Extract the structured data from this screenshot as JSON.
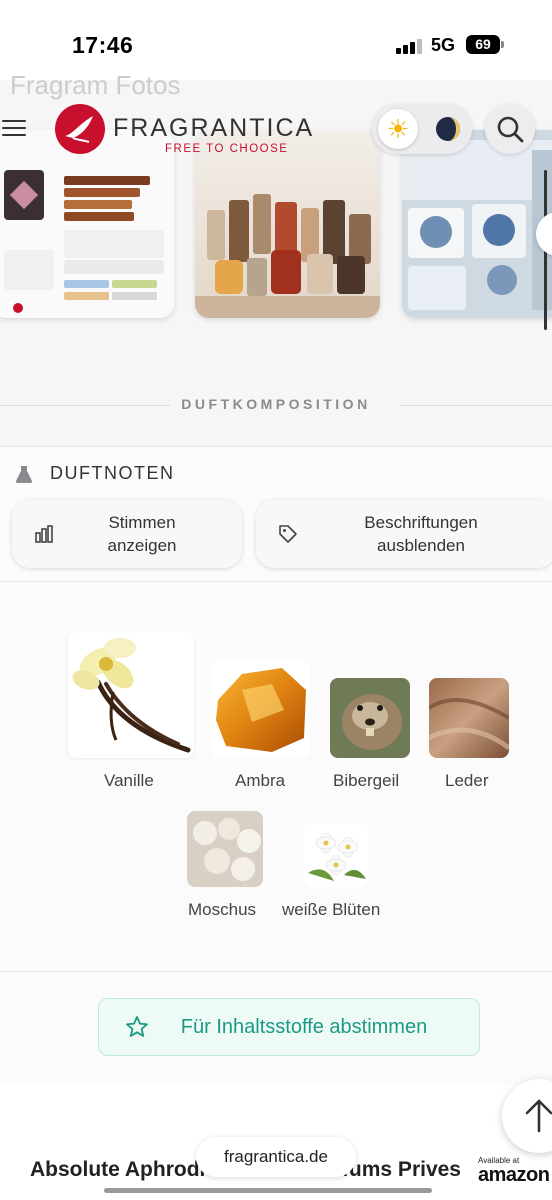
{
  "status_bar": {
    "time": "17:46",
    "network": "5G",
    "battery": "69"
  },
  "header": {
    "partial_title": "Fragram Fotos",
    "brand": "FRAGRANTICA",
    "tagline": "FREE TO CHOOSE"
  },
  "section": {
    "heading": "DUFTKOMPOSITION"
  },
  "notes": {
    "title": "DUFTNOTEN",
    "votes_button": "Stimmen anzeigen",
    "labels_button": "Beschriftungen ausblenden",
    "items": [
      {
        "label": "Vanille"
      },
      {
        "label": "Ambra"
      },
      {
        "label": "Bibergeil"
      },
      {
        "label": "Leder"
      },
      {
        "label": "Moschus"
      },
      {
        "label": "weiße Blüten"
      }
    ],
    "vote_ingredients_button": "Für Inhaltsstoffe abstimmen"
  },
  "footer": {
    "product_title": "Absolute Aphrodisiac Initio Parfums Prives",
    "url": "fragrantica.de",
    "amazon_available": "Available at",
    "amazon": "amazon"
  },
  "colors": {
    "brand_red": "#c8102e",
    "accent_green": "#1c9a84"
  },
  "icons": [
    "menu-icon",
    "sun-icon",
    "moon-icon",
    "search-icon",
    "flask-icon",
    "bar-chart-icon",
    "tag-icon",
    "star-icon",
    "arrow-up-icon"
  ]
}
